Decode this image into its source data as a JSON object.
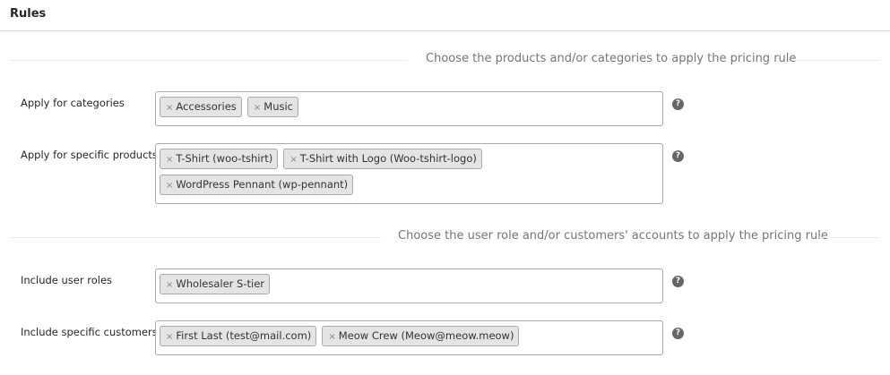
{
  "panel": {
    "title": "Rules"
  },
  "sections": [
    {
      "heading": "Choose the products and/or categories to apply the pricing rule"
    },
    {
      "heading": "Choose the user role and/or customers' accounts to apply the pricing rule"
    }
  ],
  "fields": {
    "categories": {
      "label": "Apply for categories",
      "chips": [
        "Accessories",
        "Music"
      ],
      "help_icon": "question-mark-icon"
    },
    "products": {
      "label": "Apply for specific products",
      "chips": [
        "T-Shirt (woo-tshirt)",
        "T-Shirt with Logo (Woo-tshirt-logo)",
        "WordPress Pennant (wp-pennant)"
      ],
      "help_icon": "question-mark-icon"
    },
    "roles": {
      "label": "Include user roles",
      "chips": [
        "Wholesaler S-tier"
      ],
      "help_icon": "question-mark-icon"
    },
    "customers": {
      "label": "Include specific customers",
      "chips": [
        "First Last (test@mail.com)",
        "Meow Crew (Meow@meow.meow)"
      ],
      "help_icon": "question-mark-icon"
    }
  },
  "icons": {
    "remove": "×",
    "help": "?"
  },
  "colors": {
    "chip_bg": "#e4e4e4",
    "help_icon": "#666666",
    "border": "#aaaaaa"
  }
}
